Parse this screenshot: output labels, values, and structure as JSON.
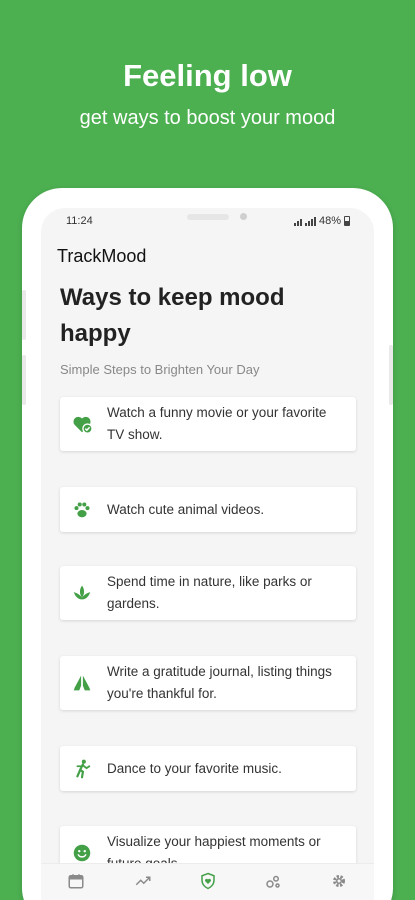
{
  "promo": {
    "title": "Feeling low",
    "subtitle": "get ways to boost your mood"
  },
  "status_bar": {
    "time": "11:24",
    "battery": "48%"
  },
  "app": {
    "title": "TrackMood"
  },
  "page": {
    "title": "Ways to keep mood happy",
    "subtitle": "Simple Steps to Brighten Your Day"
  },
  "tips": [
    {
      "icon": "heart-check-icon",
      "text": "Watch a funny movie or your favorite TV show."
    },
    {
      "icon": "paw-icon",
      "text": "Watch cute animal videos."
    },
    {
      "icon": "leaf-icon",
      "text": "Spend time in nature, like parks or gardens."
    },
    {
      "icon": "praying-hands-icon",
      "text": "Write a gratitude journal, listing things you're thankful for."
    },
    {
      "icon": "dancing-person-icon",
      "text": "Dance to your favorite music."
    },
    {
      "icon": "smiley-icon",
      "text": "Visualize your happiest moments or future goals."
    }
  ],
  "bottom_nav": {
    "items": [
      {
        "icon": "calendar-icon",
        "active": false
      },
      {
        "icon": "trend-chart-icon",
        "active": false
      },
      {
        "icon": "shield-heart-icon",
        "active": true
      },
      {
        "icon": "bubbles-icon",
        "active": false
      },
      {
        "icon": "gear-icon",
        "active": false
      }
    ]
  },
  "colors": {
    "brand": "#4caf50",
    "icon_green": "#43a047",
    "inactive_icon": "#8a8a8a"
  }
}
